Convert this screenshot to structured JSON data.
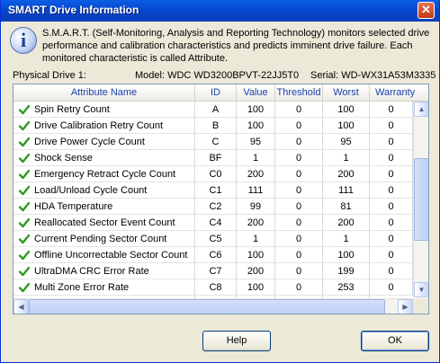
{
  "window": {
    "title": "SMART Drive Information",
    "close_glyph": "✕"
  },
  "info": {
    "icon": "info-icon",
    "text": "S.M.A.R.T. (Self-Monitoring, Analysis and Reporting Technology) monitors selected drive performance and calibration characteristics and predicts imminent drive failure. Each monitored characteristic is called Attribute."
  },
  "drive": {
    "physical": "Physical Drive 1:",
    "model": "Model: WDC WD3200BPVT-22JJ5T0",
    "serial": "Serial: WD-WX31A53M3335"
  },
  "table": {
    "columns": [
      "Attribute Name",
      "ID",
      "Value",
      "Threshold",
      "Worst",
      "Warranty"
    ],
    "rows": [
      {
        "name": "Spin Retry Count",
        "id": "A",
        "value": "100",
        "threshold": "0",
        "worst": "100",
        "warranty": "0"
      },
      {
        "name": "Drive Calibration Retry Count",
        "id": "B",
        "value": "100",
        "threshold": "0",
        "worst": "100",
        "warranty": "0"
      },
      {
        "name": "Drive Power Cycle Count",
        "id": "C",
        "value": "95",
        "threshold": "0",
        "worst": "95",
        "warranty": "0"
      },
      {
        "name": "Shock Sense",
        "id": "BF",
        "value": "1",
        "threshold": "0",
        "worst": "1",
        "warranty": "0"
      },
      {
        "name": "Emergency Retract Cycle Count",
        "id": "C0",
        "value": "200",
        "threshold": "0",
        "worst": "200",
        "warranty": "0"
      },
      {
        "name": "Load/Unload Cycle Count",
        "id": "C1",
        "value": "111",
        "threshold": "0",
        "worst": "111",
        "warranty": "0"
      },
      {
        "name": "HDA Temperature",
        "id": "C2",
        "value": "99",
        "threshold": "0",
        "worst": "81",
        "warranty": "0"
      },
      {
        "name": "Reallocated Sector Event Count",
        "id": "C4",
        "value": "200",
        "threshold": "0",
        "worst": "200",
        "warranty": "0"
      },
      {
        "name": "Current Pending Sector Count",
        "id": "C5",
        "value": "1",
        "threshold": "0",
        "worst": "1",
        "warranty": "0"
      },
      {
        "name": "Offline Uncorrectable Sector Count",
        "id": "C6",
        "value": "100",
        "threshold": "0",
        "worst": "100",
        "warranty": "0"
      },
      {
        "name": "UltraDMA CRC Error Rate",
        "id": "C7",
        "value": "200",
        "threshold": "0",
        "worst": "199",
        "warranty": "0"
      },
      {
        "name": "Multi Zone Error Rate",
        "id": "C8",
        "value": "100",
        "threshold": "0",
        "worst": "253",
        "warranty": "0"
      }
    ]
  },
  "scrollbar": {
    "up": "▲",
    "down": "▼",
    "left": "◀",
    "right": "▶"
  },
  "buttons": {
    "help": "Help",
    "ok": "OK"
  },
  "colors": {
    "check": "#2e9a1f",
    "header_text": "#1a3fad",
    "titlebar": "#0846cf"
  }
}
